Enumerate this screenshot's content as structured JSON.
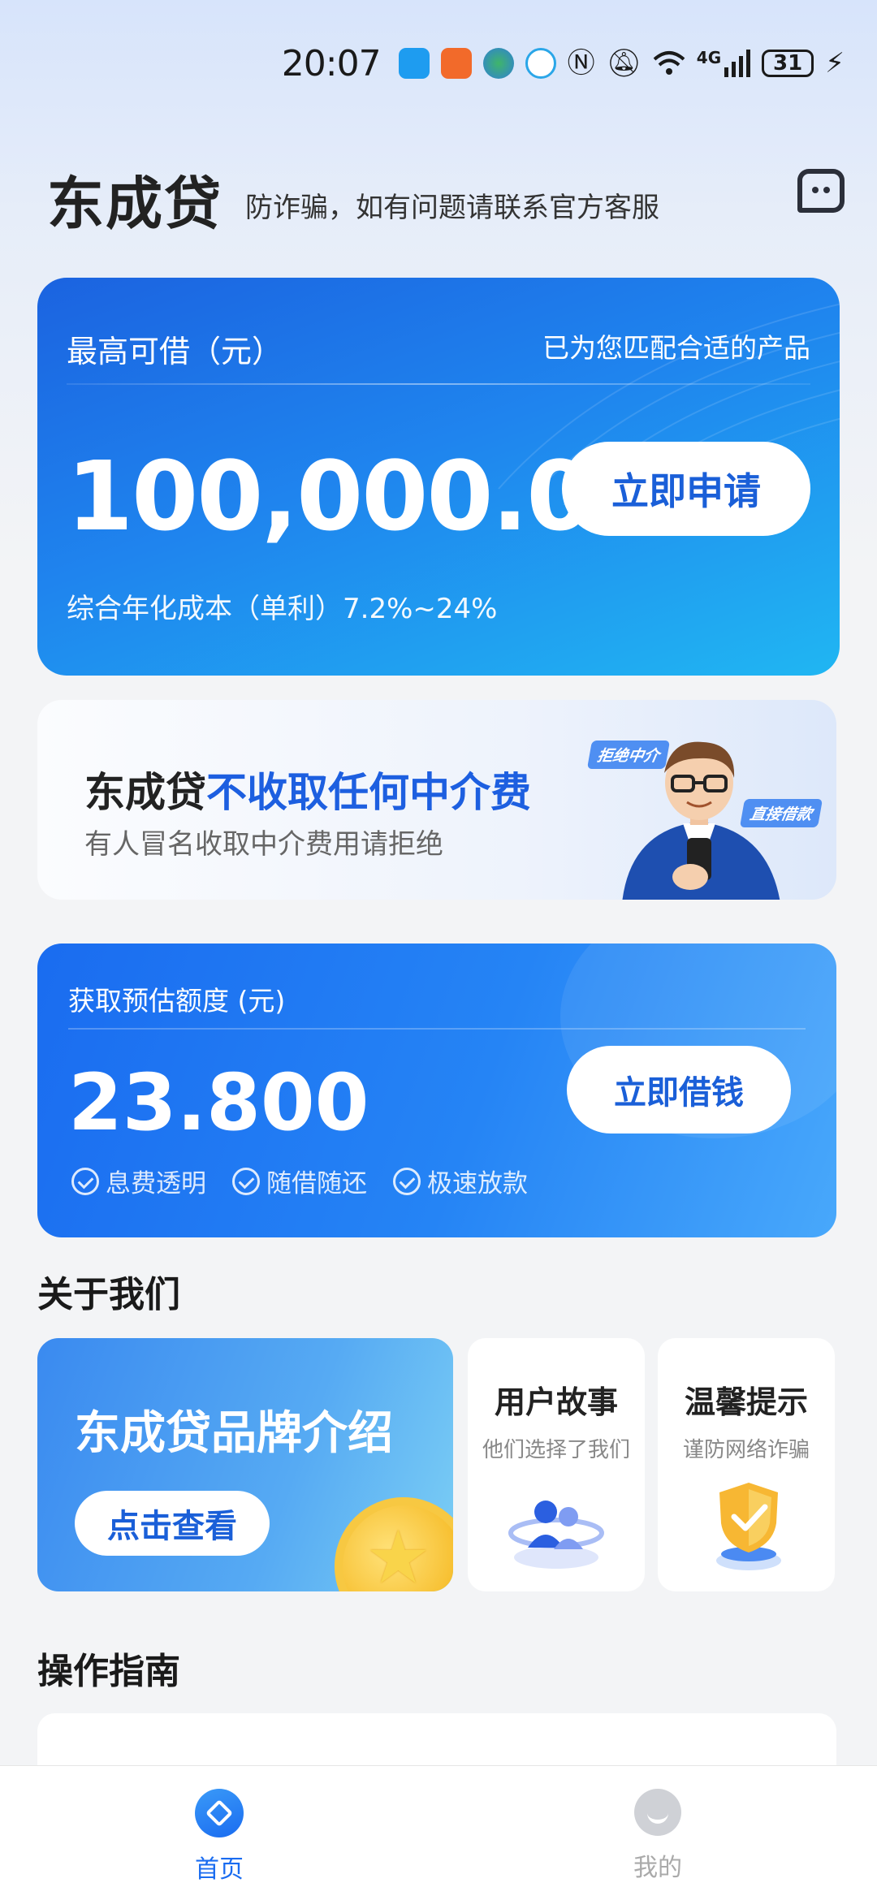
{
  "status_bar": {
    "time": "20:07",
    "battery": "31",
    "network": "4G"
  },
  "header": {
    "title": "东成贷",
    "subtitle": "防诈骗，如有问题请联系官方客服"
  },
  "hero": {
    "label": "最高可借（元）",
    "matched_text": "已为您匹配合适的产品",
    "amount": "100,000.00",
    "rate_text": "综合年化成本（单利）7.2%~24%",
    "apply_label": "立即申请"
  },
  "promo": {
    "brand": "东成贷",
    "highlight": "不收取任何中介费",
    "sub": "有人冒名收取中介费用请拒绝",
    "tag_reject": "拒绝中介",
    "tag_direct": "直接借款"
  },
  "estimate": {
    "label": "获取预估额度 (元)",
    "amount": "23.800",
    "borrow_label": "立即借钱",
    "features": [
      "息费透明",
      "随借随还",
      "极速放款"
    ]
  },
  "about": {
    "title": "关于我们",
    "brand_title": "东成贷品牌介绍",
    "view_label": "点击查看",
    "story_title": "用户故事",
    "story_sub": "他们选择了我们",
    "tips_title": "温馨提示",
    "tips_sub": "谨防网络诈骗"
  },
  "guide": {
    "title": "操作指南"
  },
  "nav": {
    "home": "首页",
    "mine": "我的"
  },
  "colors": {
    "primary": "#1a6cf0",
    "accent_text": "#1d5fe0",
    "coin": "#f5b820"
  }
}
